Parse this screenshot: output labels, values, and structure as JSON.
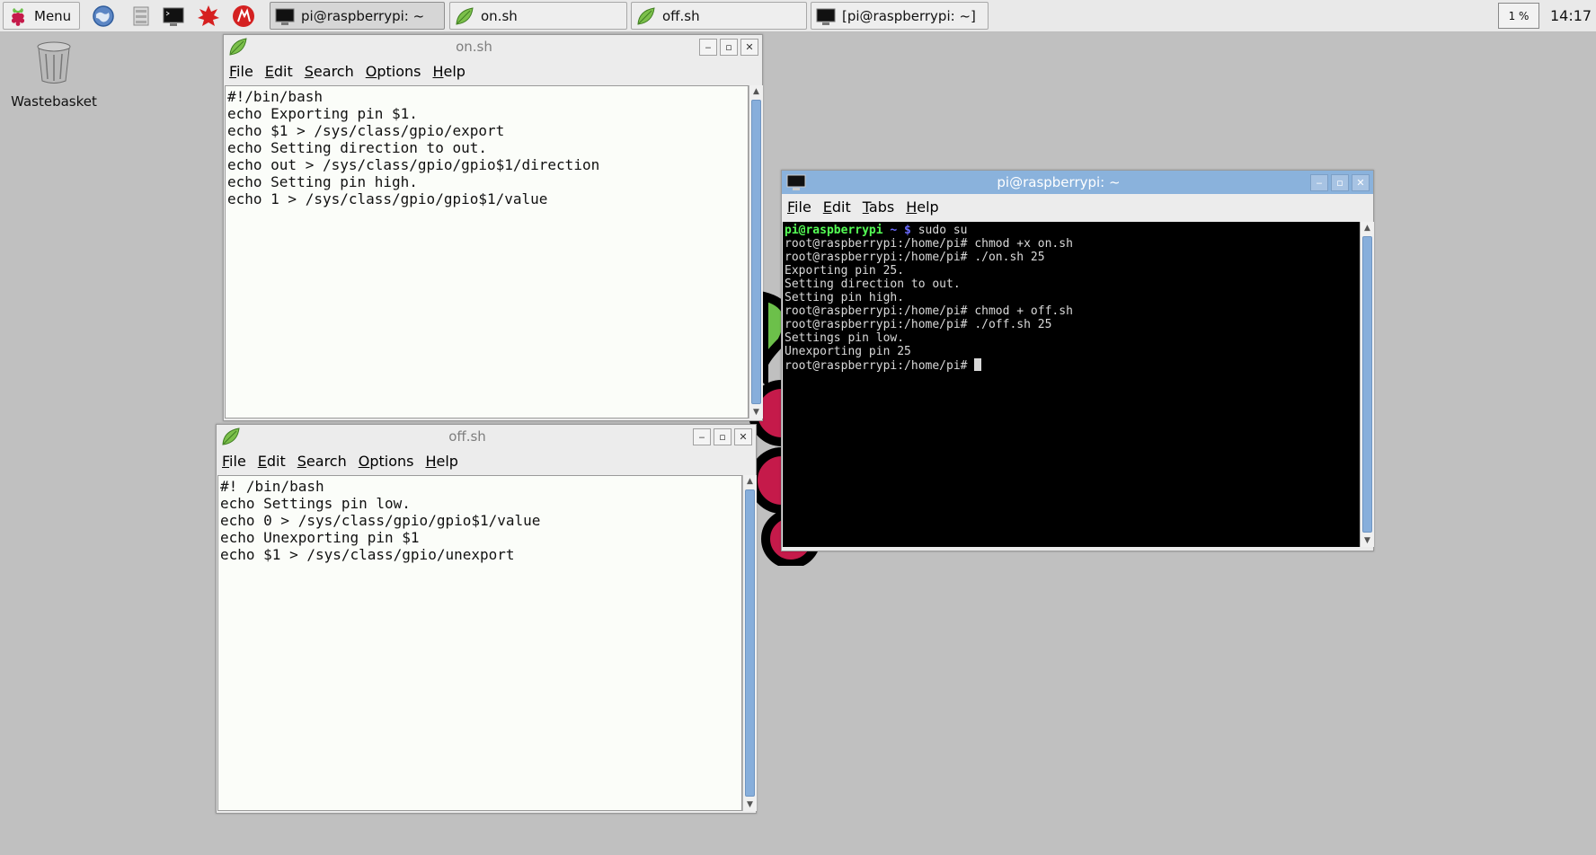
{
  "taskbar": {
    "menu_label": "Menu",
    "tasks": [
      {
        "label": "pi@raspberrypi: ~",
        "icon": "terminal-icon",
        "active": true
      },
      {
        "label": "on.sh",
        "icon": "leafpad-icon"
      },
      {
        "label": "off.sh",
        "icon": "leafpad-icon"
      },
      {
        "label": "[pi@raspberrypi: ~]",
        "icon": "terminal-icon"
      }
    ],
    "cpu_label": "1 %",
    "clock": "14:17"
  },
  "desktop": {
    "wastebasket_label": "Wastebasket"
  },
  "windows": {
    "on_sh": {
      "title": "on.sh",
      "menu": [
        "File",
        "Edit",
        "Search",
        "Options",
        "Help"
      ],
      "content": "#!/bin/bash\necho Exporting pin $1.\necho $1 > /sys/class/gpio/export\necho Setting direction to out.\necho out > /sys/class/gpio/gpio$1/direction\necho Setting pin high.\necho 1 > /sys/class/gpio/gpio$1/value"
    },
    "off_sh": {
      "title": "off.sh",
      "menu": [
        "File",
        "Edit",
        "Search",
        "Options",
        "Help"
      ],
      "content": "#! /bin/bash\necho Settings pin low.\necho 0 > /sys/class/gpio/gpio$1/value\necho Unexporting pin $1\necho $1 > /sys/class/gpio/unexport"
    },
    "terminal": {
      "title": "pi@raspberrypi: ~",
      "menu": [
        "File",
        "Edit",
        "Tabs",
        "Help"
      ],
      "prompt_user": "pi@raspberrypi",
      "prompt_path": " ~ $",
      "first_command": " sudo su",
      "lines": [
        "root@raspberrypi:/home/pi# chmod +x on.sh",
        "root@raspberrypi:/home/pi# ./on.sh 25",
        "Exporting pin 25.",
        "Setting direction to out.",
        "Setting pin high.",
        "root@raspberrypi:/home/pi# chmod + off.sh",
        "root@raspberrypi:/home/pi# ./off.sh 25",
        "Settings pin low.",
        "Unexporting pin 25"
      ],
      "last_prompt": "root@raspberrypi:/home/pi# "
    }
  },
  "colors": {
    "desktop": "#c0c0c0",
    "active_titlebar": "#8ab2dc",
    "terminal_bg": "#000000",
    "raspberry_red": "#c51a4a",
    "raspberry_green": "#6cc04a"
  }
}
